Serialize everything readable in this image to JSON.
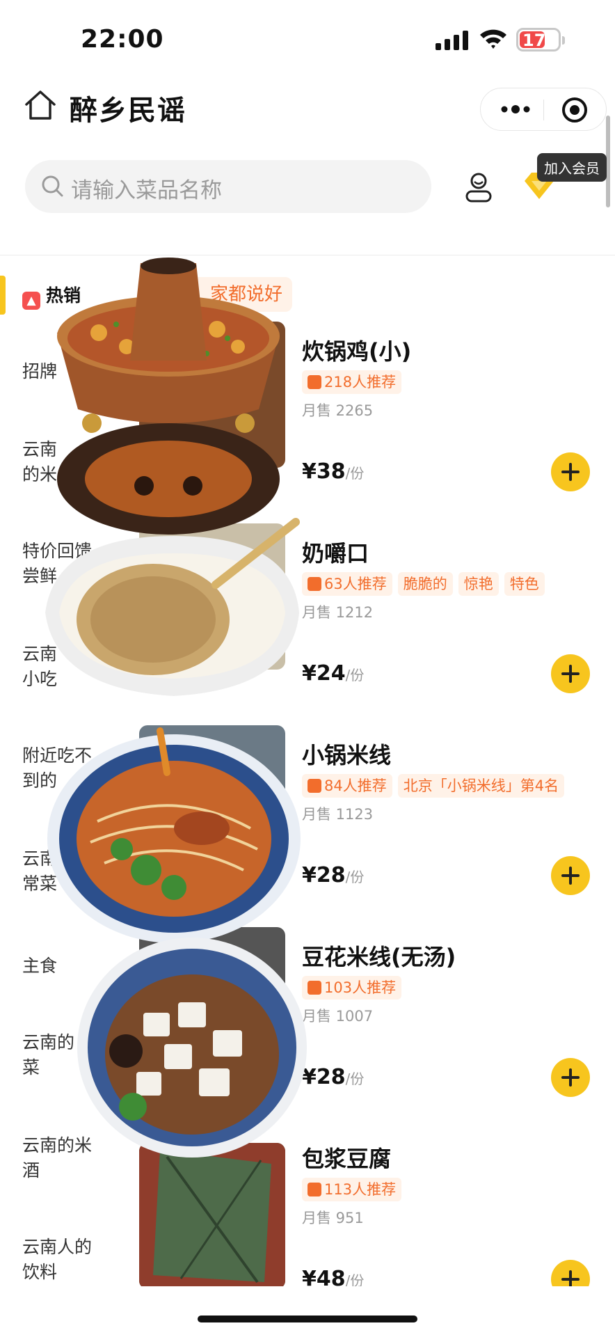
{
  "status": {
    "time": "22:00",
    "battery": "17"
  },
  "header": {
    "title": "醉乡民谣"
  },
  "search": {
    "placeholder": "请输入菜品名称",
    "join_tip": "加入会员"
  },
  "banner": {
    "text": "家都说好"
  },
  "sidebar": {
    "active": "热销",
    "items": [
      {
        "label": "招牌"
      },
      {
        "label": "云南\n的米"
      },
      {
        "label": "特价回馈\n尝鲜"
      },
      {
        "label": "云南\n小吃"
      },
      {
        "label": "附近吃不\n到的"
      },
      {
        "label": "云南\n常菜"
      },
      {
        "label": "主食"
      },
      {
        "label": "云南的\n菜"
      },
      {
        "label": "云南的米\n酒"
      },
      {
        "label": "云南人的\n饮料"
      }
    ]
  },
  "dishes": [
    {
      "name": "炊锅鸡(小)",
      "tags": [
        "218人推荐"
      ],
      "sales": "月售 2265",
      "price": "¥38",
      "unit": "/份"
    },
    {
      "name": "奶嚼口",
      "tags": [
        "63人推荐",
        "脆脆的",
        "惊艳",
        "特色"
      ],
      "sales": "月售 1212",
      "price": "¥24",
      "unit": "/份"
    },
    {
      "name": "小锅米线",
      "tags": [
        "84人推荐",
        "北京「小锅米线」第4名"
      ],
      "sales": "月售 1123",
      "price": "¥28",
      "unit": "/份"
    },
    {
      "name": "豆花米线(无汤)",
      "tags": [
        "103人推荐"
      ],
      "sales": "月售 1007",
      "price": "¥28",
      "unit": "/份"
    },
    {
      "name": "包浆豆腐",
      "tags": [
        "113人推荐"
      ],
      "sales": "月售 951",
      "price": "¥48",
      "unit": "/份"
    }
  ],
  "colors": {
    "accent": "#f7c51e",
    "tag_text": "#f26d2c",
    "tag_bg": "#fff2e8"
  }
}
